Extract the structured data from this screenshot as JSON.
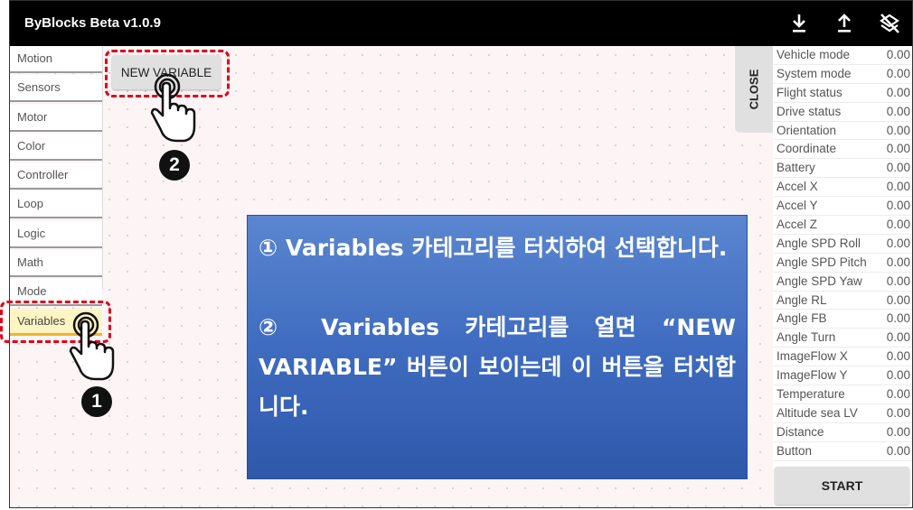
{
  "app": {
    "title": "ByBlocks Beta v1.0.9"
  },
  "toolbar": {
    "icons": [
      "download-icon",
      "upload-icon",
      "clear-icon"
    ]
  },
  "categories": [
    {
      "label": "Motion"
    },
    {
      "label": "Sensors"
    },
    {
      "label": "Motor"
    },
    {
      "label": "Color"
    },
    {
      "label": "Controller"
    },
    {
      "label": "Loop"
    },
    {
      "label": "Logic"
    },
    {
      "label": "Math"
    },
    {
      "label": "Mode"
    },
    {
      "label": "Variables",
      "selected": true
    }
  ],
  "new_variable_button": "NEW VARIABLE",
  "close_tab": "CLOSE",
  "markers": {
    "one": "1",
    "two": "2"
  },
  "variables": [
    {
      "name": "Vehicle mode",
      "value": "0.00"
    },
    {
      "name": "System mode",
      "value": "0.00"
    },
    {
      "name": "Flight status",
      "value": "0.00"
    },
    {
      "name": "Drive status",
      "value": "0.00"
    },
    {
      "name": "Orientation",
      "value": "0.00"
    },
    {
      "name": "Coordinate",
      "value": "0.00"
    },
    {
      "name": "Battery",
      "value": "0.00"
    },
    {
      "name": "Accel X",
      "value": "0.00"
    },
    {
      "name": "Accel Y",
      "value": "0.00"
    },
    {
      "name": "Accel Z",
      "value": "0.00"
    },
    {
      "name": "Angle SPD Roll",
      "value": "0.00"
    },
    {
      "name": "Angle SPD Pitch",
      "value": "0.00"
    },
    {
      "name": "Angle SPD Yaw",
      "value": "0.00"
    },
    {
      "name": "Angle RL",
      "value": "0.00"
    },
    {
      "name": "Angle FB",
      "value": "0.00"
    },
    {
      "name": "Angle Turn",
      "value": "0.00"
    },
    {
      "name": "ImageFlow X",
      "value": "0.00"
    },
    {
      "name": "ImageFlow Y",
      "value": "0.00"
    },
    {
      "name": "Temperature",
      "value": "0.00"
    },
    {
      "name": "Altitude sea LV",
      "value": "0.00"
    },
    {
      "name": "Distance",
      "value": "0.00"
    },
    {
      "name": "Button",
      "value": "0.00"
    }
  ],
  "start_button": "START",
  "callout": {
    "step1": "① Variables 카테고리를 터치하여 선택합니다.",
    "step2": "② Variables 카테고리를 열면 “NEW VARIABLE” 버튼이 보이는데 이 버튼을 터치합니다."
  },
  "colors": {
    "accent_dash": "#e0001a",
    "callout_bg": "#4472c4",
    "selected_category": "#fff5c2",
    "titlebar": "#000000"
  }
}
